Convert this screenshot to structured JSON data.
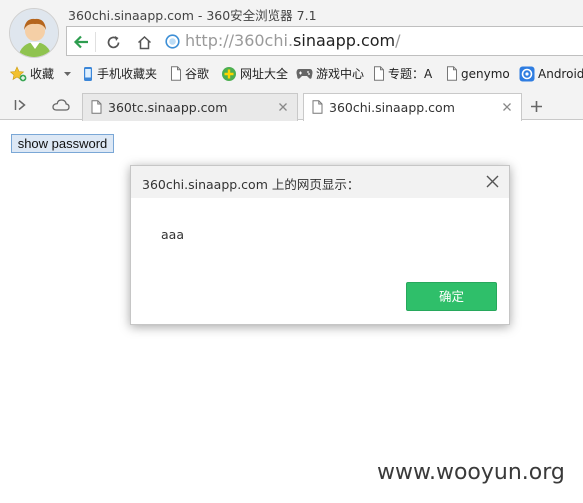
{
  "window": {
    "title": "360chi.sinaapp.com - 360安全浏览器 7.1"
  },
  "address_bar": {
    "url_scheme": "http://",
    "url_sub": "360chi.",
    "url_domain": "sinaapp.com",
    "url_path": "/"
  },
  "bookmarks": [
    {
      "label": "收藏",
      "icon": "star-icon"
    },
    {
      "label": "手机收藏夹",
      "icon": "phone-icon"
    },
    {
      "label": "谷歌",
      "icon": "page-icon"
    },
    {
      "label": "网址大全",
      "icon": "web-directory-icon"
    },
    {
      "label": "游戏中心",
      "icon": "gamepad-icon"
    },
    {
      "label": "专题：A",
      "icon": "page-icon"
    },
    {
      "label": "genymo",
      "icon": "page-icon"
    },
    {
      "label": "Android",
      "icon": "android-icon"
    }
  ],
  "tabs": [
    {
      "label": "360tc.sinaapp.com",
      "active": false
    },
    {
      "label": "360chi.sinaapp.com",
      "active": true
    }
  ],
  "page": {
    "show_password_label": "show password"
  },
  "dialog": {
    "title": "360chi.sinaapp.com 上的网页显示：",
    "message": "aaa",
    "ok_label": "确定"
  },
  "watermark": "www.wooyun.org",
  "colors": {
    "ok_button": "#2fbf6a",
    "back_arrow": "#2e9d4f",
    "url_domain": "#222222",
    "url_muted": "#9a9a9a"
  }
}
